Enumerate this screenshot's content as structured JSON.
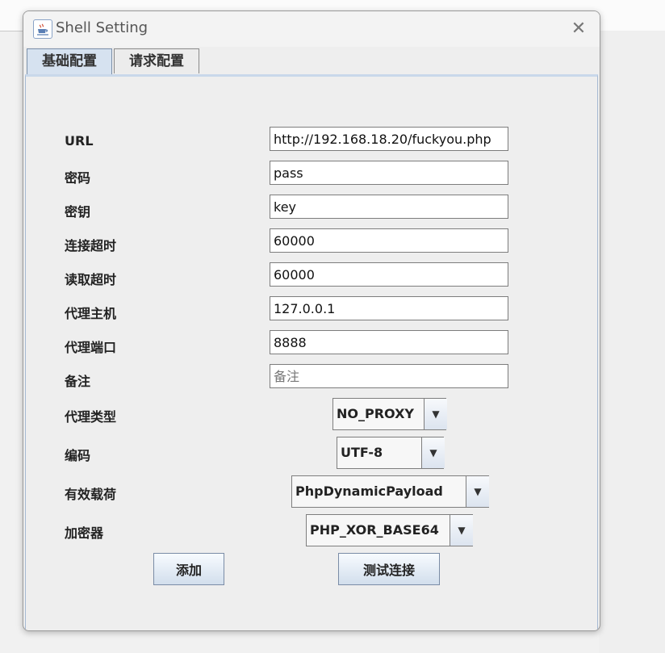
{
  "window": {
    "title": "Shell Setting",
    "close_symbol": "✕"
  },
  "tabs": [
    {
      "label": "基础配置",
      "active": true
    },
    {
      "label": "请求配置",
      "active": false
    }
  ],
  "form": {
    "url": {
      "label": "URL",
      "value": "http://192.168.18.20/fuckyou.php"
    },
    "password": {
      "label": "密码",
      "value": "pass"
    },
    "secret": {
      "label": "密钥",
      "value": "key"
    },
    "connect_timeout": {
      "label": "连接超时",
      "value": "60000"
    },
    "read_timeout": {
      "label": "读取超时",
      "value": "60000"
    },
    "proxy_host": {
      "label": "代理主机",
      "value": "127.0.0.1"
    },
    "proxy_port": {
      "label": "代理端口",
      "value": "8888"
    },
    "remark": {
      "label": "备注",
      "value": "",
      "placeholder": "备注"
    },
    "proxy_type": {
      "label": "代理类型",
      "value": "NO_PROXY"
    },
    "encoding": {
      "label": "编码",
      "value": "UTF-8"
    },
    "payload": {
      "label": "有效载荷",
      "value": "PhpDynamicPayload"
    },
    "encryptor": {
      "label": "加密器",
      "value": "PHP_XOR_BASE64"
    }
  },
  "buttons": {
    "add": "添加",
    "test": "测试连接"
  },
  "colors": {
    "tab_active": "#d6e2f0",
    "panel_border": "#a6b9d2",
    "button_gradient_bottom": "#d2deec"
  },
  "icons": {
    "app": "java-coffee-icon",
    "close": "close-icon",
    "dropdown": "chevron-down-icon"
  }
}
